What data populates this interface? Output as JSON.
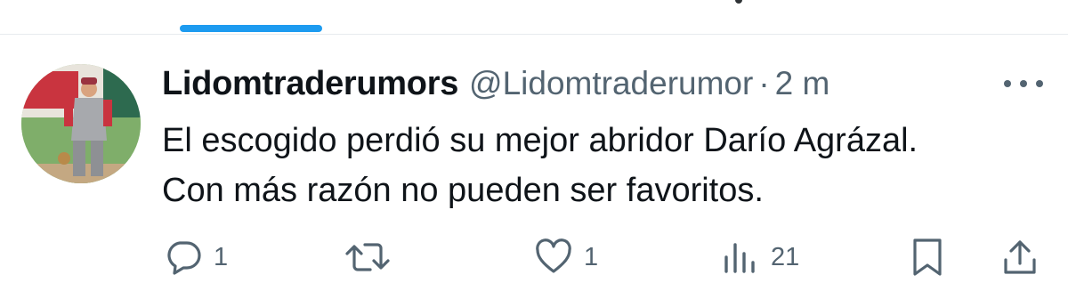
{
  "tweet": {
    "author_name": "Lidomtraderumors",
    "author_handle": "@Lidomtraderumor",
    "separator": "·",
    "timestamp": "2 m",
    "text_lines": [
      "El escogido perdió su mejor abridor Darío Agrázal.",
      "Con más razón no pueden ser favoritos."
    ]
  },
  "actions": {
    "reply_count": "1",
    "like_count": "1",
    "views_count": "21"
  },
  "icons": {
    "reply": "reply-icon",
    "retweet": "retweet-icon",
    "like": "heart-icon",
    "views": "views-icon",
    "bookmark": "bookmark-icon",
    "share": "share-icon",
    "more": "more-icon"
  },
  "colors": {
    "accent": "#1d9bf0",
    "text": "#0f1419",
    "secondary": "#536471"
  }
}
